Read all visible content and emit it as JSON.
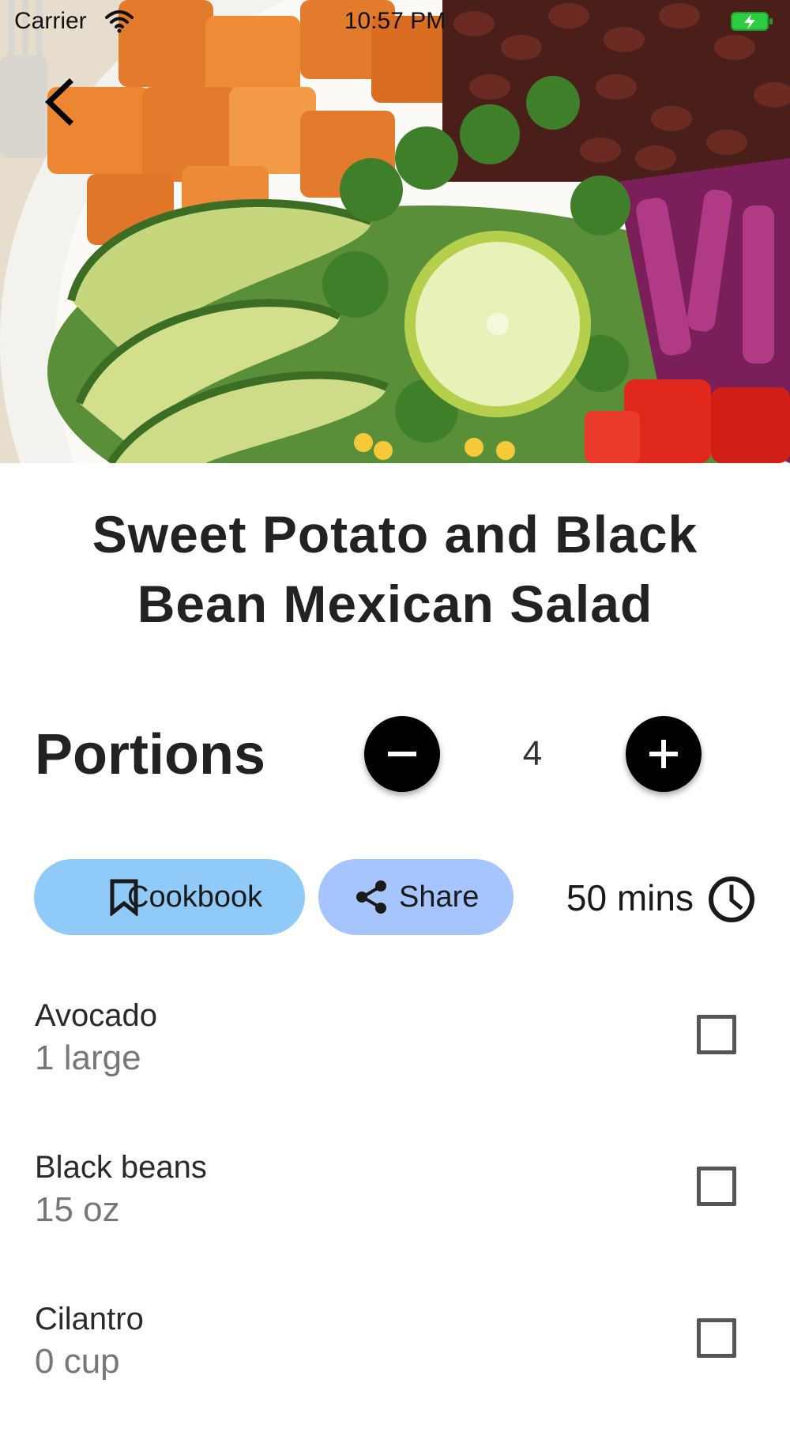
{
  "status_bar": {
    "carrier": "Carrier",
    "time": "10:57 PM",
    "wifi_icon": "wifi-icon",
    "battery_icon": "battery-charging-icon",
    "battery_color": "#2ecc40"
  },
  "navigation": {
    "back_icon": "chevron-left-icon"
  },
  "recipe": {
    "title_line1": "Sweet Potato and Black",
    "title_line2": "Bean Mexican Salad"
  },
  "portions": {
    "label": "Portions",
    "value": "4",
    "decrement_icon": "minus-icon",
    "increment_icon": "plus-icon"
  },
  "actions": {
    "cookbook_label": "Cookbook",
    "cookbook_icon": "bookmark-icon",
    "cookbook_color": "#90caf9",
    "share_label": "Share",
    "share_icon": "share-icon",
    "share_color": "#a6c4fd"
  },
  "duration": {
    "text": "50 mins",
    "icon": "clock-icon"
  },
  "ingredients": [
    {
      "name": "Avocado",
      "quantity": "1 large",
      "checked": false
    },
    {
      "name": "Black beans",
      "quantity": "15 oz",
      "checked": false
    },
    {
      "name": "Cilantro",
      "quantity": "0 cup",
      "checked": false
    }
  ]
}
